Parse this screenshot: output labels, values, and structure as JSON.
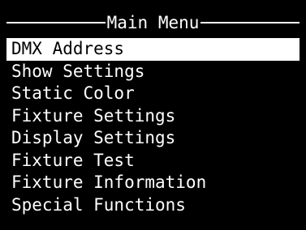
{
  "colors": {
    "background": "#000000",
    "foreground": "#ffffff",
    "highlight_background": "#ffffff",
    "highlight_foreground": "#000000"
  },
  "menu": {
    "title": "Main Menu",
    "selected_index": 0,
    "items": [
      {
        "label": "DMX Address"
      },
      {
        "label": "Show Settings"
      },
      {
        "label": "Static Color"
      },
      {
        "label": "Fixture Settings"
      },
      {
        "label": "Display Settings"
      },
      {
        "label": "Fixture Test"
      },
      {
        "label": "Fixture Information"
      },
      {
        "label": "Special Functions"
      }
    ]
  }
}
